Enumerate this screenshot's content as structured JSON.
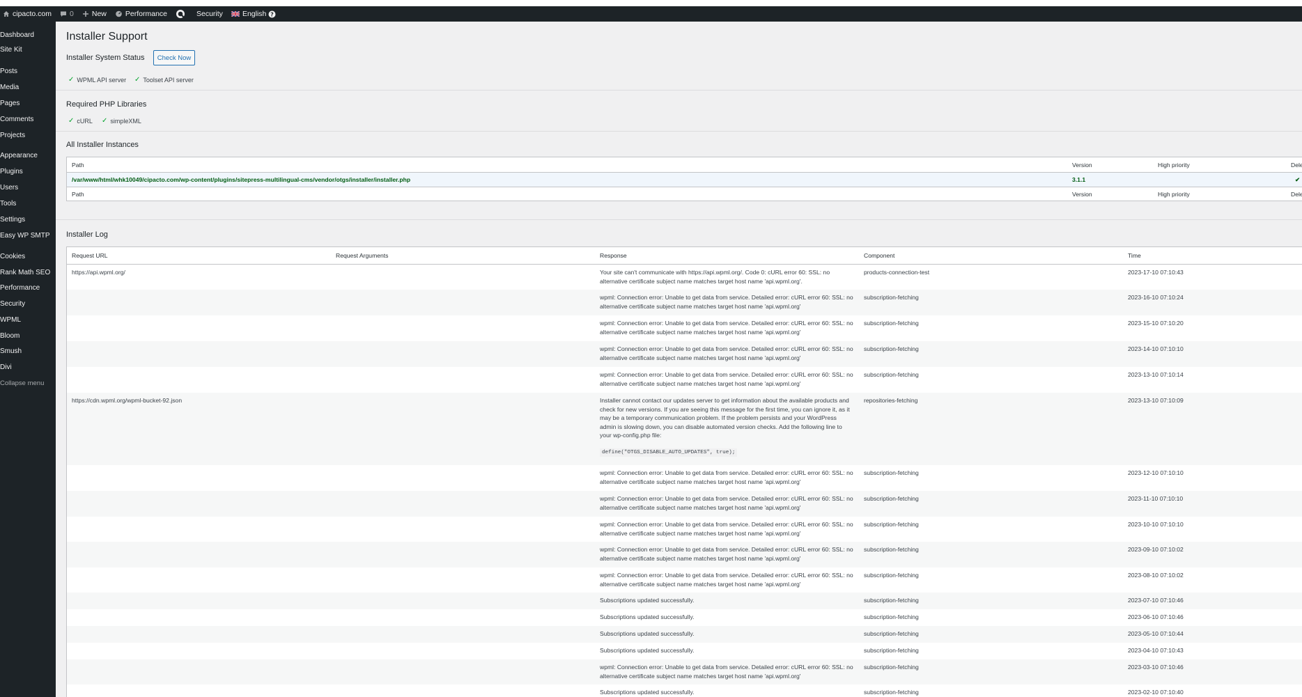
{
  "admin_bar": {
    "site": "cipacto.com",
    "comments": "0",
    "new": "New",
    "performance": "Performance",
    "security": "Security",
    "language": "English"
  },
  "sidebar": {
    "items": [
      "Dashboard",
      "Site Kit",
      "Posts",
      "Media",
      "Pages",
      "Comments",
      "Projects",
      "Appearance",
      "Plugins",
      "Users",
      "Tools",
      "Settings",
      "Easy WP SMTP",
      "Cookies",
      "Rank Math SEO",
      "Performance",
      "Security",
      "WPML",
      "Bloom",
      "Smush",
      "Divi"
    ],
    "collapse": "Collapse menu"
  },
  "page": {
    "title": "Installer Support",
    "status_title": "Installer System Status",
    "check_now": "Check Now",
    "servers": [
      "WPML API server",
      "Toolset API server"
    ],
    "php_title": "Required PHP Libraries",
    "php_libs": [
      "cURL",
      "simpleXML"
    ],
    "instances_title": "All Installer Instances",
    "log_title": "Installer Log"
  },
  "instances": {
    "headers": [
      "Path",
      "Version",
      "High priority",
      "Delegated"
    ],
    "rows": [
      {
        "path": "/var/www/html/whk10049/cipacto.com/wp-content/plugins/sitepress-multilingual-cms/vendor/otgs/installer/installer.php",
        "version": "3.1.1",
        "high_priority": "",
        "delegated": "✔"
      }
    ]
  },
  "log": {
    "headers": [
      "Request URL",
      "Request Arguments",
      "Response",
      "Component",
      "Time"
    ],
    "rows": [
      {
        "url": "https://api.wpml.org/",
        "args": "",
        "response": "Your site can't communicate with https://api.wpml.org/. Code 0: cURL error 60: SSL: no alternative certificate subject name matches target host name 'api.wpml.org'.",
        "component": "products-connection-test",
        "time": "2023-17-10 07:10:43"
      },
      {
        "url": "",
        "args": "",
        "response": "wpml: Connection error: Unable to get data from service. Detailed error: cURL error 60: SSL: no alternative certificate subject name matches target host name 'api.wpml.org'",
        "component": "subscription-fetching",
        "time": "2023-16-10 07:10:24"
      },
      {
        "url": "",
        "args": "",
        "response": "wpml: Connection error: Unable to get data from service. Detailed error: cURL error 60: SSL: no alternative certificate subject name matches target host name 'api.wpml.org'",
        "component": "subscription-fetching",
        "time": "2023-15-10 07:10:20"
      },
      {
        "url": "",
        "args": "",
        "response": "wpml: Connection error: Unable to get data from service. Detailed error: cURL error 60: SSL: no alternative certificate subject name matches target host name 'api.wpml.org'",
        "component": "subscription-fetching",
        "time": "2023-14-10 07:10:10"
      },
      {
        "url": "",
        "args": "",
        "response": "wpml: Connection error: Unable to get data from service. Detailed error: cURL error 60: SSL: no alternative certificate subject name matches target host name 'api.wpml.org'",
        "component": "subscription-fetching",
        "time": "2023-13-10 07:10:14"
      },
      {
        "url": "https://cdn.wpml.org/wpml-bucket-92.json",
        "args": "",
        "response": "Installer cannot contact our updates server to get information about the available products and check for new versions. If you are seeing this message for the first time, you can ignore it, as it may be a temporary communication problem. If the problem persists and your WordPress admin is slowing down, you can disable automated version checks. Add the following line to your wp-config.php file:",
        "code": "define(\"OTGS_DISABLE_AUTO_UPDATES\", true);",
        "component": "repositories-fetching",
        "time": "2023-13-10 07:10:09"
      },
      {
        "url": "",
        "args": "",
        "response": "wpml: Connection error: Unable to get data from service. Detailed error: cURL error 60: SSL: no alternative certificate subject name matches target host name 'api.wpml.org'",
        "component": "subscription-fetching",
        "time": "2023-12-10 07:10:10"
      },
      {
        "url": "",
        "args": "",
        "response": "wpml: Connection error: Unable to get data from service. Detailed error: cURL error 60: SSL: no alternative certificate subject name matches target host name 'api.wpml.org'",
        "component": "subscription-fetching",
        "time": "2023-11-10 07:10:10"
      },
      {
        "url": "",
        "args": "",
        "response": "wpml: Connection error: Unable to get data from service. Detailed error: cURL error 60: SSL: no alternative certificate subject name matches target host name 'api.wpml.org'",
        "component": "subscription-fetching",
        "time": "2023-10-10 07:10:10"
      },
      {
        "url": "",
        "args": "",
        "response": "wpml: Connection error: Unable to get data from service. Detailed error: cURL error 60: SSL: no alternative certificate subject name matches target host name 'api.wpml.org'",
        "component": "subscription-fetching",
        "time": "2023-09-10 07:10:02"
      },
      {
        "url": "",
        "args": "",
        "response": "wpml: Connection error: Unable to get data from service. Detailed error: cURL error 60: SSL: no alternative certificate subject name matches target host name 'api.wpml.org'",
        "component": "subscription-fetching",
        "time": "2023-08-10 07:10:02"
      },
      {
        "url": "",
        "args": "",
        "response": "Subscriptions updated successfully.",
        "component": "subscription-fetching",
        "time": "2023-07-10 07:10:46"
      },
      {
        "url": "",
        "args": "",
        "response": "Subscriptions updated successfully.",
        "component": "subscription-fetching",
        "time": "2023-06-10 07:10:46"
      },
      {
        "url": "",
        "args": "",
        "response": "Subscriptions updated successfully.",
        "component": "subscription-fetching",
        "time": "2023-05-10 07:10:44"
      },
      {
        "url": "",
        "args": "",
        "response": "Subscriptions updated successfully.",
        "component": "subscription-fetching",
        "time": "2023-04-10 07:10:43"
      },
      {
        "url": "",
        "args": "",
        "response": "wpml: Connection error: Unable to get data from service. Detailed error: cURL error 60: SSL: no alternative certificate subject name matches target host name 'api.wpml.org'",
        "component": "subscription-fetching",
        "time": "2023-03-10 07:10:46"
      },
      {
        "url": "",
        "args": "",
        "response": "Subscriptions updated successfully.",
        "component": "subscription-fetching",
        "time": "2023-02-10 07:10:40"
      }
    ]
  }
}
